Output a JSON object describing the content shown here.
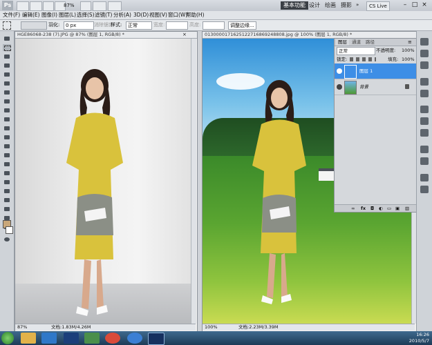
{
  "app": {
    "logo": "Ps",
    "zoom_select": "87%",
    "workspaces": [
      "基本功能",
      "设计",
      "绘画",
      "摄影"
    ],
    "cs_live": "CS Live",
    "window_buttons": [
      "–",
      "□",
      "×"
    ]
  },
  "menu": [
    "文件(F)",
    "编辑(E)",
    "图像(I)",
    "图层(L)",
    "选择(S)",
    "滤镜(T)",
    "分析(A)",
    "3D(D)",
    "视图(V)",
    "窗口(W)",
    "帮助(H)"
  ],
  "options": {
    "feather_label": "羽化:",
    "feather_value": "0 px",
    "antialias_label": "消除锯齿",
    "style_label": "样式:",
    "style_value": "正常",
    "width_label": "宽度:",
    "height_label": "高度:",
    "refine_edge": "调整边缘..."
  },
  "doc_left": {
    "tab": "HGE86068-238 (7).JPG @ 87% (图层 1, RGB/8) *",
    "zoom": "87%",
    "info": "文档:1.83M/4.26M"
  },
  "doc_right": {
    "tab": "013000017162512271686924880​8.jpg @ 100% (图层 1, RGB/8) *",
    "zoom": "100%",
    "info": "文档:2.23M/3.39M"
  },
  "layers_panel": {
    "tabs": [
      "图层",
      "通道",
      "路径"
    ],
    "blend_mode": "正常",
    "opacity_label": "不透明度:",
    "opacity_value": "100%",
    "lock_label": "锁定:",
    "fill_label": "填充:",
    "fill_value": "100%",
    "layers": [
      {
        "name": "图层 1",
        "selected": true
      },
      {
        "name": "背景",
        "selected": false
      }
    ],
    "bottom_icons": [
      "link-icon",
      "fx-icon",
      "mask-icon",
      "adjustment-icon",
      "group-icon",
      "new-layer-icon",
      "trash-icon"
    ]
  },
  "taskbar": {
    "time": "16:26",
    "date": "2010/5/7"
  },
  "colors": {
    "selection_blue": "#3d8ee6",
    "foreground_swatch": "#c9a779",
    "background_swatch": "#ffffff"
  }
}
